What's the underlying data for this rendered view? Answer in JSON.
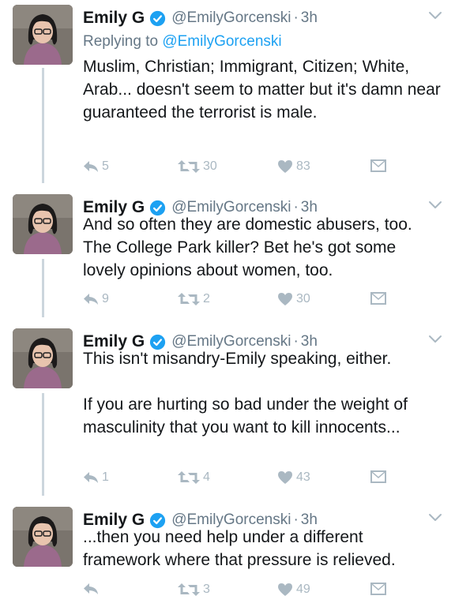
{
  "colors": {
    "text": "#14171a",
    "secondary": "#657786",
    "link": "#1da1f2",
    "action_gray": "#aab8c2",
    "thread_line": "#ccd6dd",
    "verified": "#1da1f2"
  },
  "tweets": [
    {
      "name": "Emily G",
      "handle": "@EmilyGorcenski",
      "time": "3h",
      "reply_label": "Replying to",
      "reply_handle": "@EmilyGorcenski",
      "paragraphs": [
        "Muslim, Christian; Immigrant, Citizen; White, Arab... doesn't seem to matter but it's damn near guaranteed the terrorist is male."
      ],
      "replies": "5",
      "retweets": "30",
      "likes": "83"
    },
    {
      "name": "Emily G",
      "handle": "@EmilyGorcenski",
      "time": "3h",
      "paragraphs": [
        "And so often they are domestic abusers, too. The College Park killer? Bet he's got some lovely opinions about women, too."
      ],
      "replies": "9",
      "retweets": "2",
      "likes": "30"
    },
    {
      "name": "Emily G",
      "handle": "@EmilyGorcenski",
      "time": "3h",
      "paragraphs": [
        "This isn't misandry-Emily speaking, either.",
        "If you are hurting so bad under the weight of masculinity that you want to kill innocents..."
      ],
      "replies": "1",
      "retweets": "4",
      "likes": "43"
    },
    {
      "name": "Emily G",
      "handle": "@EmilyGorcenski",
      "time": "3h",
      "paragraphs": [
        "...then you need help under a different framework where that pressure is relieved."
      ],
      "replies": "",
      "retweets": "3",
      "likes": "49"
    }
  ]
}
